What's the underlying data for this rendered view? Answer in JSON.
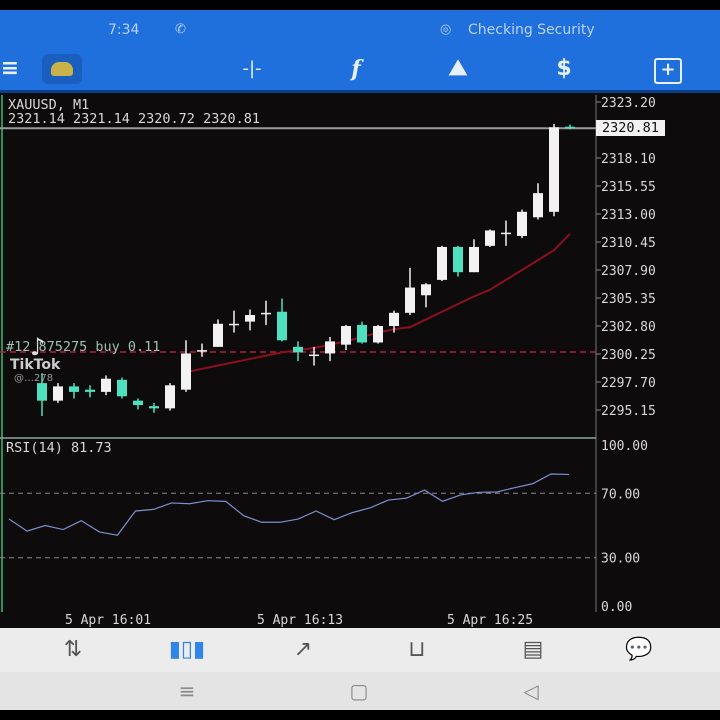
{
  "status_bar": {
    "time": "7:34",
    "notification": "Checking Security"
  },
  "toolbar": {
    "icons": [
      "menu-icon",
      "app-logo-icon",
      "crosshair-icon",
      "indicators-icon",
      "objects-icon",
      "trade-icon",
      "new-order-icon"
    ],
    "indicator_glyph": "f",
    "crosshair_glyph": "-|-",
    "trade_glyph": "$"
  },
  "chart_header": {
    "symbol": "XAUUSD, M1",
    "ohlc": "2321.14 2321.14 2320.72 2320.81"
  },
  "order_line": {
    "label": "#12 875275 buy 0.11",
    "price": 2300.43
  },
  "watermark": {
    "brand": "TikTok",
    "user": "@…278"
  },
  "colors": {
    "bull": "#f2f2f2",
    "bear": "#4fe0c0",
    "ma": "#8a1020",
    "rsi": "#2a3d8c",
    "accent": "#1f6fdc"
  },
  "chart_data": [
    {
      "type": "candlestick",
      "title": "XAUUSD, M1",
      "ylim": [
        2295.15,
        2323.2
      ],
      "price_ticks": [
        "2323.20",
        "2318.10",
        "2315.55",
        "2313.00",
        "2310.45",
        "2307.90",
        "2305.35",
        "2302.80",
        "2300.25",
        "2297.70",
        "2295.15"
      ],
      "current_price": "2320.81",
      "candles": [
        [
          2297.6,
          2298.5,
          2294.6,
          2296.0
        ],
        [
          2296.0,
          2297.6,
          2295.8,
          2297.3
        ],
        [
          2297.3,
          2297.6,
          2296.2,
          2296.8
        ],
        [
          2297.0,
          2297.4,
          2296.3,
          2296.8
        ],
        [
          2296.8,
          2298.3,
          2296.5,
          2298.0
        ],
        [
          2297.9,
          2298.1,
          2296.2,
          2296.4
        ],
        [
          2296.0,
          2296.2,
          2295.2,
          2295.6
        ],
        [
          2295.5,
          2295.8,
          2294.9,
          2295.3
        ],
        [
          2295.3,
          2297.6,
          2295.1,
          2297.4
        ],
        [
          2297.0,
          2301.5,
          2296.8,
          2300.3
        ],
        [
          2300.6,
          2301.2,
          2300.0,
          2300.6
        ],
        [
          2300.9,
          2303.4,
          2300.9,
          2303.0
        ],
        [
          2303.0,
          2304.2,
          2302.2,
          2303.0
        ],
        [
          2303.2,
          2304.3,
          2302.4,
          2303.8
        ],
        [
          2304.0,
          2305.1,
          2302.9,
          2304.0
        ],
        [
          2304.1,
          2305.3,
          2301.4,
          2301.5
        ],
        [
          2300.9,
          2301.4,
          2299.6,
          2300.4
        ],
        [
          2300.2,
          2300.9,
          2299.2,
          2300.2
        ],
        [
          2300.3,
          2301.8,
          2299.6,
          2301.4
        ],
        [
          2301.1,
          2302.9,
          2300.6,
          2302.8
        ],
        [
          2302.9,
          2303.2,
          2301.2,
          2301.3
        ],
        [
          2301.3,
          2302.9,
          2301.2,
          2302.8
        ],
        [
          2302.8,
          2304.2,
          2302.2,
          2304.0
        ],
        [
          2304.0,
          2308.1,
          2303.8,
          2306.3
        ],
        [
          2305.6,
          2306.7,
          2304.5,
          2306.6
        ],
        [
          2307.0,
          2310.1,
          2306.9,
          2310.0
        ],
        [
          2310.0,
          2310.1,
          2307.3,
          2307.7
        ],
        [
          2307.7,
          2310.7,
          2307.7,
          2310.0
        ],
        [
          2310.1,
          2311.6,
          2310.0,
          2311.5
        ],
        [
          2311.3,
          2312.4,
          2310.1,
          2311.3
        ],
        [
          2311.0,
          2313.4,
          2310.8,
          2313.2
        ],
        [
          2312.7,
          2315.8,
          2312.5,
          2314.9
        ],
        [
          2313.2,
          2321.2,
          2312.8,
          2320.9
        ],
        [
          2320.95,
          2321.14,
          2320.72,
          2320.81
        ]
      ],
      "ma": [
        null,
        null,
        null,
        null,
        null,
        null,
        null,
        null,
        null,
        2298.6,
        2298.9,
        2299.2,
        2299.5,
        2299.8,
        2300.1,
        2300.4,
        2300.6,
        2300.8,
        2301.1,
        2301.4,
        2301.8,
        2302.2,
        2302.5,
        2302.7,
        2303.4,
        2304.1,
        2304.8,
        2305.5,
        2306.1,
        2307.0,
        2307.9,
        2308.8,
        2309.7,
        2311.2
      ],
      "time_labels": [
        "5 Apr 16:01",
        "5 Apr 16:13",
        "5 Apr 16:25"
      ]
    },
    {
      "type": "line",
      "title": "RSI(14) 81.73",
      "ylim": [
        0,
        100
      ],
      "ticks": [
        "100.00",
        "70.00",
        "30.00",
        "0.00"
      ],
      "levels": [
        70,
        30
      ],
      "values": [
        54,
        46.5,
        50,
        47.5,
        53,
        46,
        44,
        59,
        60,
        64,
        63.5,
        65.4,
        65,
        56,
        52,
        52,
        54,
        59,
        53.6,
        58,
        61,
        65.8,
        67,
        72,
        65,
        69,
        70.6,
        70.8,
        73.5,
        76,
        82,
        81.73
      ]
    }
  ],
  "bottom_nav": [
    "quotes-icon",
    "chart-icon",
    "trade-icon",
    "history-icon",
    "news-icon",
    "messages-icon"
  ],
  "system_nav": [
    "recent-apps-icon",
    "home-icon",
    "back-icon"
  ]
}
